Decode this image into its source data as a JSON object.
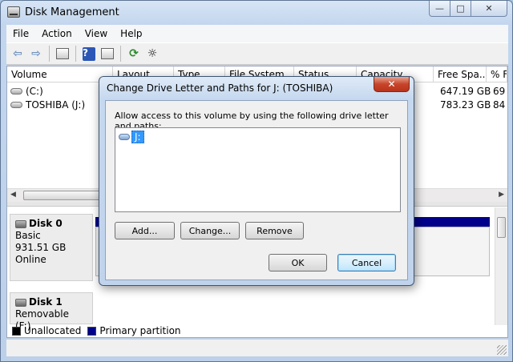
{
  "window": {
    "title": "Disk Management"
  },
  "caption": {
    "min": "—",
    "max": "□",
    "close": "✕"
  },
  "menu": [
    "File",
    "Action",
    "View",
    "Help"
  ],
  "toolbar_icons": [
    "back-arrow-icon",
    "forward-arrow-icon",
    "console-tree-icon",
    "help-icon",
    "properties-icon",
    "refresh-icon",
    "rescan-disks-icon"
  ],
  "volume_list": {
    "columns": [
      "Volume",
      "Layout",
      "Type",
      "File System",
      "Status",
      "Capacity",
      "Free Spa...",
      "% F"
    ],
    "rows": [
      {
        "name": "(C:)",
        "free": "647.19 GB",
        "pct": "69"
      },
      {
        "name": "TOSHIBA (J:)",
        "free": "783.23 GB",
        "pct": "84"
      }
    ]
  },
  "disks": [
    {
      "name": "Disk 0",
      "type": "Basic",
      "size": "931.51 GB",
      "status": "Online"
    },
    {
      "name": "Disk 1",
      "type": "Removable (F:)"
    }
  ],
  "legend": [
    {
      "label": "Unallocated",
      "color": "#000000"
    },
    {
      "label": "Primary partition",
      "color": "#00008b"
    }
  ],
  "dialog": {
    "title": "Change Drive Letter and Paths for J: (TOSHIBA)",
    "instruction": "Allow access to this volume by using the following drive letter and paths:",
    "paths": [
      "J:"
    ],
    "buttons": {
      "add": "Add...",
      "change": "Change...",
      "remove": "Remove",
      "ok": "OK",
      "cancel": "Cancel"
    },
    "close": "✕"
  }
}
